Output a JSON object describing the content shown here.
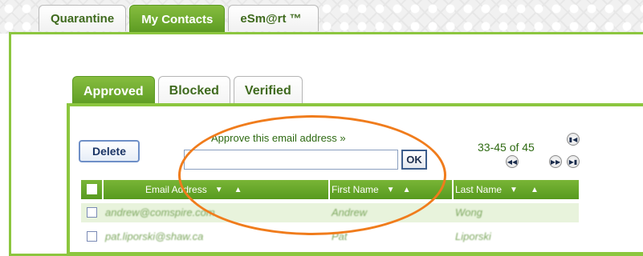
{
  "main_tabs": [
    {
      "label": "Quarantine",
      "active": false
    },
    {
      "label": "My Contacts",
      "active": true
    },
    {
      "label": "eSm@rt ™",
      "active": false
    }
  ],
  "sub_tabs": [
    {
      "label": "Approved",
      "active": true
    },
    {
      "label": "Blocked",
      "active": false
    },
    {
      "label": "Verified",
      "active": false
    }
  ],
  "toolbar": {
    "delete_label": "Delete",
    "approve_link": "Approve this email address »",
    "approve_input_value": "",
    "ok_label": "OK"
  },
  "pagination": {
    "range_text": "33-45 of 45",
    "first_icon": "first-page-icon",
    "prev_icon": "prev-page-icon",
    "next_icon": "next-page-icon",
    "last_icon": "last-page-icon"
  },
  "table": {
    "columns": [
      "Email Address",
      "First Name",
      "Last Name"
    ],
    "rows": [
      {
        "email": "andrew@comspire.com",
        "first": "Andrew",
        "last": "Wong"
      },
      {
        "email": "pat.liporski@shaw.ca",
        "first": "Pat",
        "last": "Liporski"
      }
    ]
  },
  "colors": {
    "accent_green": "#8cc63f",
    "header_green": "#579a1f",
    "annotation_orange": "#f07c1c"
  }
}
